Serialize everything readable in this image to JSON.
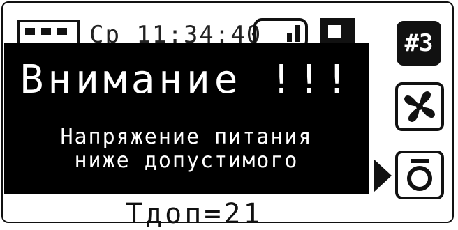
{
  "status_bar": {
    "datetime": "Ср  11:34:40"
  },
  "side_buttons": {
    "mode_label": "#3",
    "fan_icon": "fan-icon",
    "sensor_icon": "ring-sensor-icon"
  },
  "alert": {
    "title": "Внимание !!!",
    "message": "Напряжение питания\nниже допустимого"
  },
  "bottom": {
    "t_value": "Тдоп=21"
  }
}
